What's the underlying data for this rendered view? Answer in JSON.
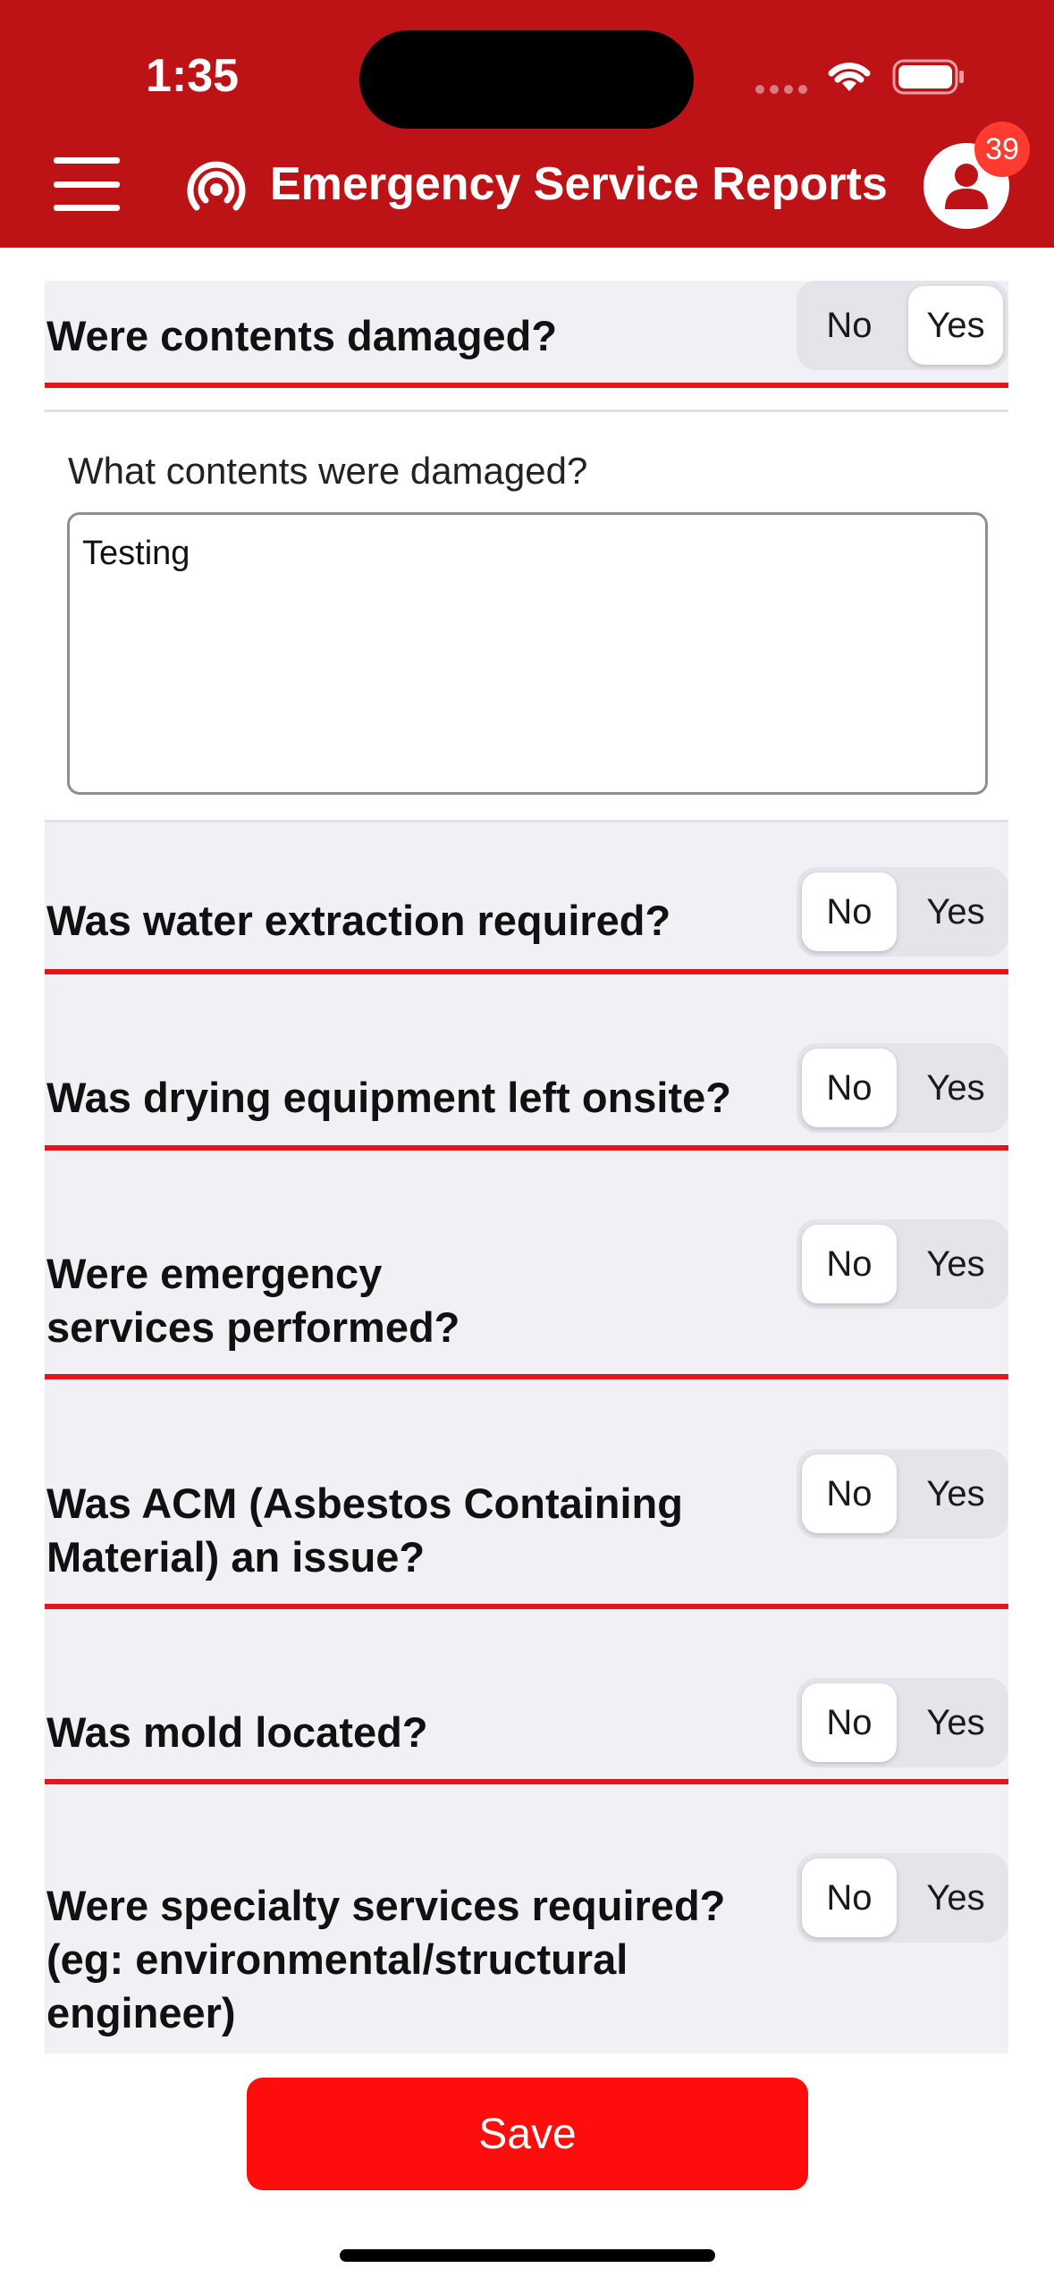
{
  "status_bar": {
    "time": "1:35"
  },
  "header": {
    "title": "Emergency Service Reports",
    "notification_count": "39"
  },
  "form": {
    "questions": [
      {
        "label": "Were contents damaged?",
        "no": "No",
        "yes": "Yes",
        "selected": "Yes"
      },
      {
        "label": "Was water extraction required?",
        "no": "No",
        "yes": "Yes",
        "selected": "No"
      },
      {
        "label": "Was drying equipment left onsite?",
        "no": "No",
        "yes": "Yes",
        "selected": "No"
      },
      {
        "label": "Were emergency\nservices performed?",
        "no": "No",
        "yes": "Yes",
        "selected": "No"
      },
      {
        "label": "Was ACM (Asbestos Containing\nMaterial) an issue?",
        "no": "No",
        "yes": "Yes",
        "selected": "No"
      },
      {
        "label": "Was mold located?",
        "no": "No",
        "yes": "Yes",
        "selected": "No"
      },
      {
        "label": "Were specialty services required?\n(eg: environmental/structural\nengineer)",
        "no": "No",
        "yes": "Yes",
        "selected": "No"
      }
    ],
    "contents_detail": {
      "label": "What contents were damaged?",
      "value": "Testing"
    }
  },
  "actions": {
    "save_label": "Save"
  },
  "colors": {
    "header_bg": "#be1316",
    "accent_red": "#ff0d0d",
    "divider_red": "#e3161b",
    "badge": "#ff3b30"
  }
}
